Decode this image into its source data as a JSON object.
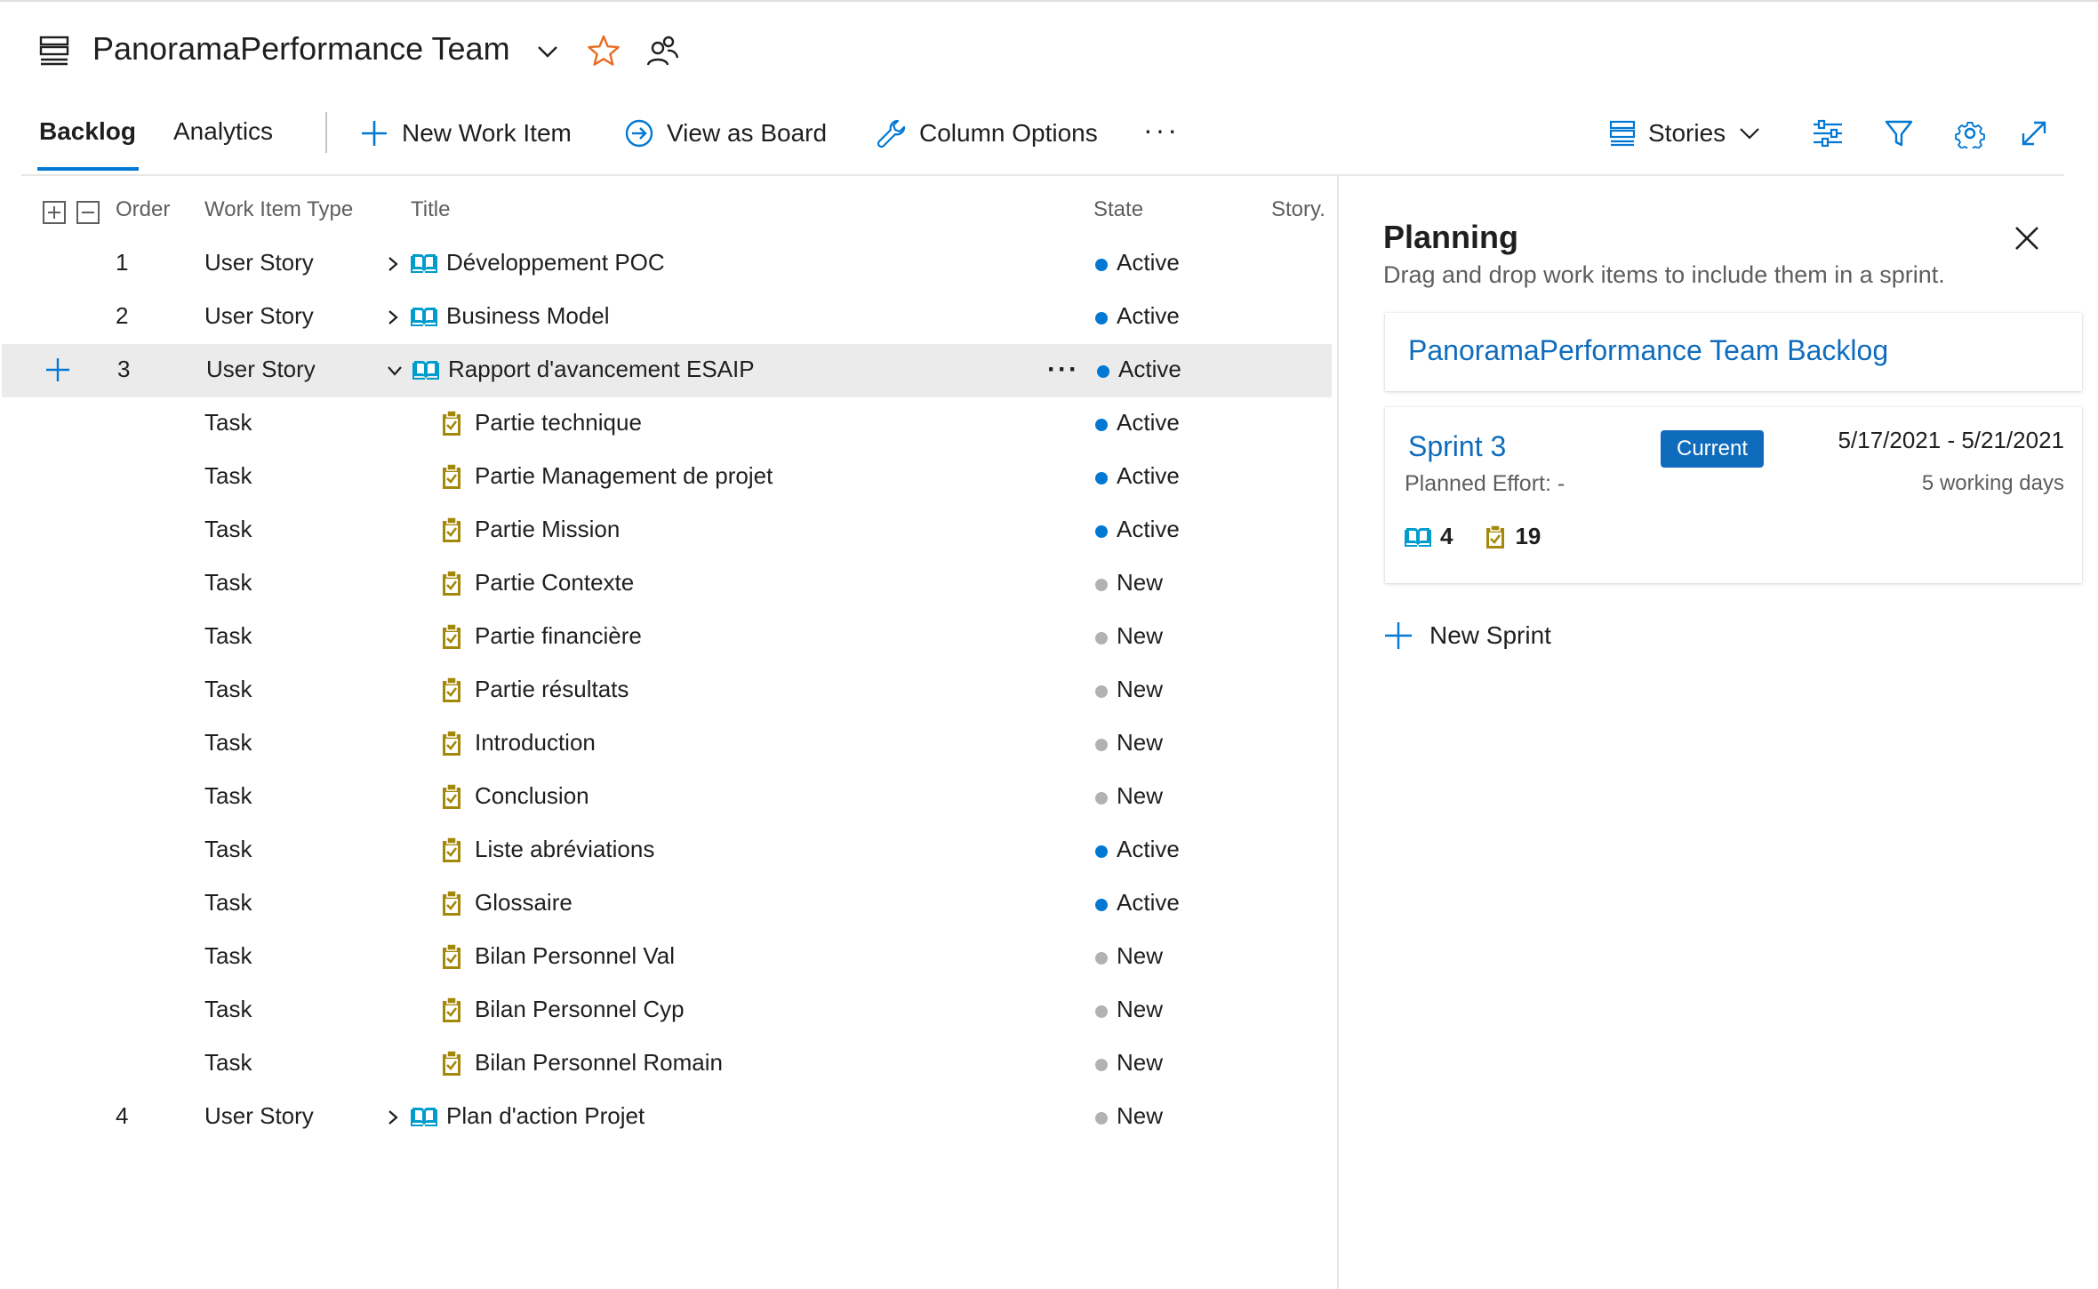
{
  "header": {
    "team_name": "PanoramaPerformance Team"
  },
  "toolbar": {
    "tabs": [
      {
        "label": "Backlog",
        "active": true
      },
      {
        "label": "Analytics",
        "active": false
      }
    ],
    "new_work_item": "New Work Item",
    "view_as_board": "View as Board",
    "column_options": "Column Options",
    "more": "···",
    "backlog_level": "Stories"
  },
  "table": {
    "columns": {
      "order": "Order",
      "type": "Work Item Type",
      "title": "Title",
      "state": "State",
      "story": "Story."
    },
    "rows": [
      {
        "order": "1",
        "type": "User Story",
        "title": "Développement POC",
        "state": "Active",
        "kind": "story",
        "chevron": "right"
      },
      {
        "order": "2",
        "type": "User Story",
        "title": "Business Model",
        "state": "Active",
        "kind": "story",
        "chevron": "right"
      },
      {
        "order": "3",
        "type": "User Story",
        "title": "Rapport d'avancement ESAIP",
        "state": "Active",
        "kind": "story",
        "chevron": "down",
        "selected": true
      },
      {
        "order": "",
        "type": "Task",
        "title": "Partie technique",
        "state": "Active",
        "kind": "task"
      },
      {
        "order": "",
        "type": "Task",
        "title": "Partie Management de projet",
        "state": "Active",
        "kind": "task"
      },
      {
        "order": "",
        "type": "Task",
        "title": "Partie Mission",
        "state": "Active",
        "kind": "task"
      },
      {
        "order": "",
        "type": "Task",
        "title": "Partie Contexte",
        "state": "New",
        "kind": "task"
      },
      {
        "order": "",
        "type": "Task",
        "title": "Partie financière",
        "state": "New",
        "kind": "task"
      },
      {
        "order": "",
        "type": "Task",
        "title": "Partie résultats",
        "state": "New",
        "kind": "task"
      },
      {
        "order": "",
        "type": "Task",
        "title": "Introduction",
        "state": "New",
        "kind": "task"
      },
      {
        "order": "",
        "type": "Task",
        "title": "Conclusion",
        "state": "New",
        "kind": "task"
      },
      {
        "order": "",
        "type": "Task",
        "title": "Liste abréviations",
        "state": "Active",
        "kind": "task"
      },
      {
        "order": "",
        "type": "Task",
        "title": "Glossaire",
        "state": "Active",
        "kind": "task"
      },
      {
        "order": "",
        "type": "Task",
        "title": "Bilan Personnel Val",
        "state": "New",
        "kind": "task"
      },
      {
        "order": "",
        "type": "Task",
        "title": "Bilan Personnel Cyp",
        "state": "New",
        "kind": "task"
      },
      {
        "order": "",
        "type": "Task",
        "title": "Bilan Personnel Romain",
        "state": "New",
        "kind": "task"
      },
      {
        "order": "4",
        "type": "User Story",
        "title": "Plan d'action Projet",
        "state": "New",
        "kind": "story",
        "chevron": "right"
      }
    ]
  },
  "state_colors": {
    "Active": "#0078d4",
    "New": "#b2b2b2"
  },
  "icon_colors": {
    "story": "#009ccc",
    "task": "#a4880a"
  },
  "planning": {
    "title": "Planning",
    "subtitle": "Drag and drop work items to include them in a sprint.",
    "backlog_label": "PanoramaPerformance Team Backlog",
    "sprint": {
      "name": "Sprint 3",
      "badge": "Current",
      "dates": "5/17/2021 - 5/21/2021",
      "planned_effort": "Planned Effort: -",
      "working_days": "5 working days",
      "story_count": "4",
      "task_count": "19"
    },
    "new_sprint": "New Sprint"
  }
}
